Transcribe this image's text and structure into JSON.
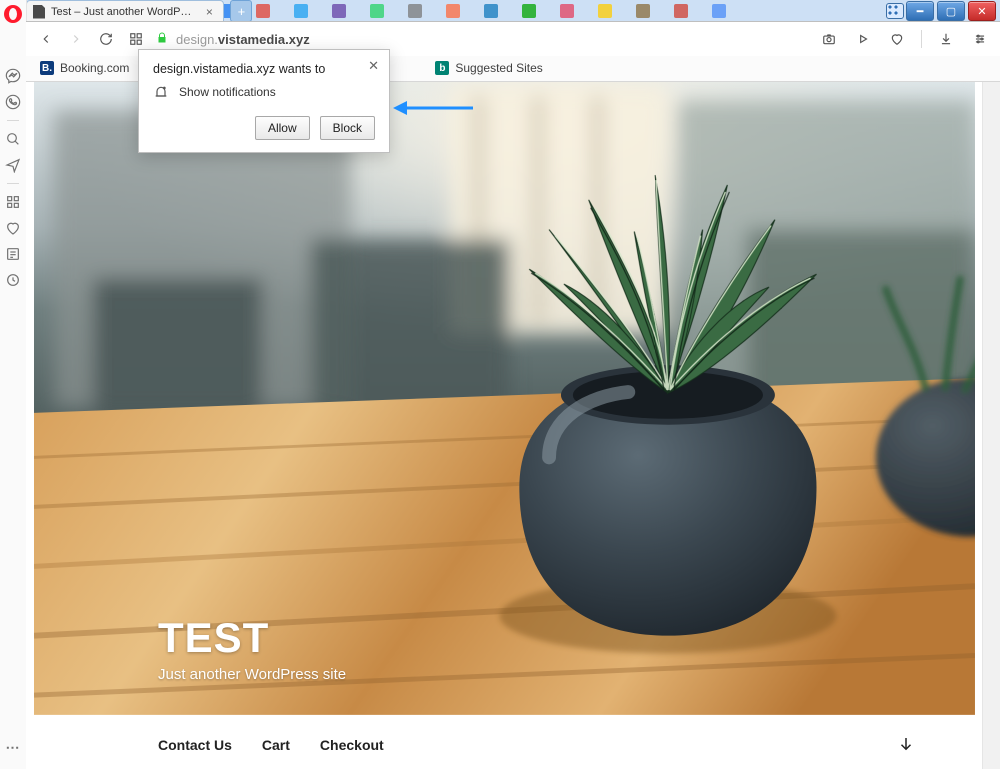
{
  "tab": {
    "title": "Test – Just another WordP…"
  },
  "address": {
    "domain": "design.",
    "host": "vistamedia.xyz"
  },
  "bookmarks": {
    "booking": "Booking.com",
    "suggested": "Suggested Sites"
  },
  "permission": {
    "title": "design.vistamedia.xyz wants to",
    "line": "Show notifications",
    "allow": "Allow",
    "block": "Block"
  },
  "hero": {
    "title": "TEST",
    "tagline": "Just another WordPress site"
  },
  "nav": {
    "contact": "Contact Us",
    "cart": "Cart",
    "checkout": "Checkout"
  }
}
